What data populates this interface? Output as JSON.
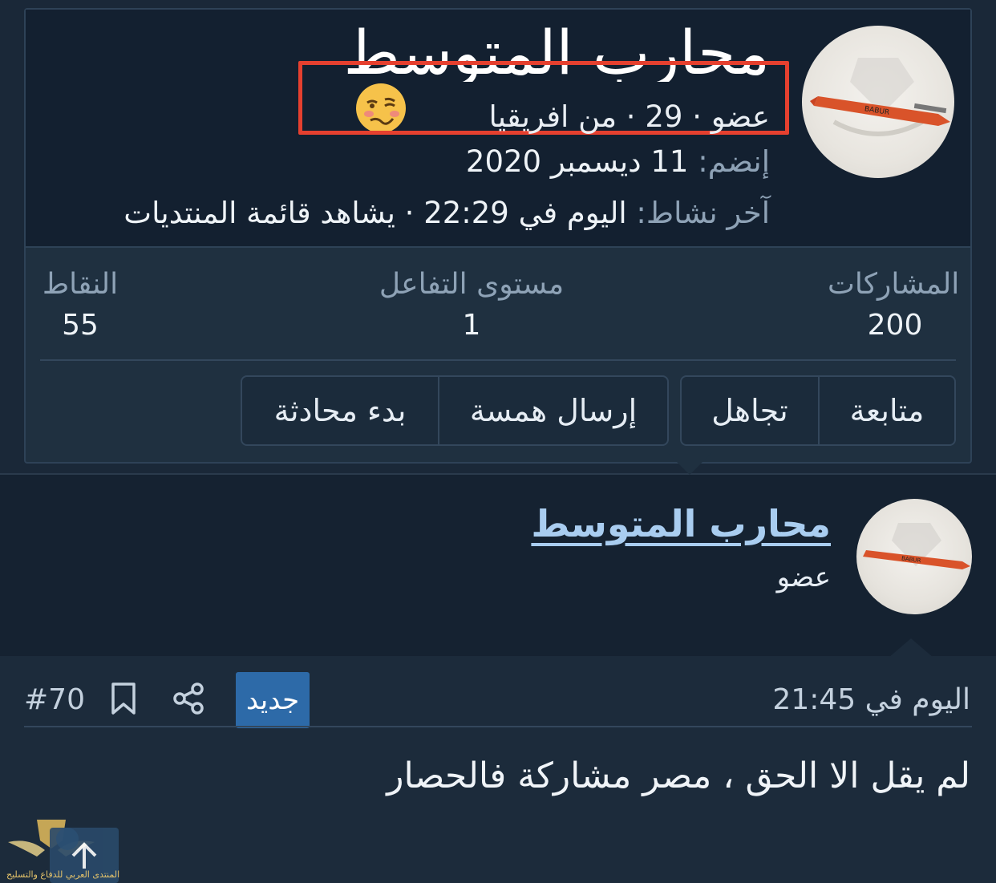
{
  "popup": {
    "name": "محارب المتوسط",
    "meta": "عضو · 29 · من افريقيا",
    "joined_label": "إنضم:",
    "joined_value": "11 ديسمبر 2020",
    "active_label": "آخر نشاط:",
    "active_value": "اليوم في 22:29 · يشاهد قائمة المنتديات",
    "stats": [
      {
        "label": "المشاركات",
        "value": "200"
      },
      {
        "label": "مستوى التفاعل",
        "value": "1"
      },
      {
        "label": "النقاط",
        "value": "55"
      }
    ],
    "buttons": {
      "follow": "متابعة",
      "ignore": "تجاهل",
      "whisper": "إرسال همسة",
      "conversation": "بدء محادثة"
    },
    "emoji_icon": "woozy-face-icon",
    "highlight_color": "#e5402f",
    "avatar_text": "BABUR"
  },
  "member": {
    "name": "محارب المتوسط",
    "title": "عضو"
  },
  "post": {
    "date": "اليوم في 21:45",
    "badge": "جديد",
    "number": "#70",
    "body": "لم يقل الا الحق ، مصر مشاركة فالحصار",
    "share_icon": "share-icon",
    "bookmark_icon": "bookmark-icon"
  },
  "overlay": {
    "scroll_icon": "arrow-up-icon",
    "watermark_text": "المنتدى العربي للدفاع والتسليح"
  },
  "colors": {
    "link": "#a9cdf0",
    "badge": "#2d6aa8",
    "muted": "#8ea2b6"
  }
}
